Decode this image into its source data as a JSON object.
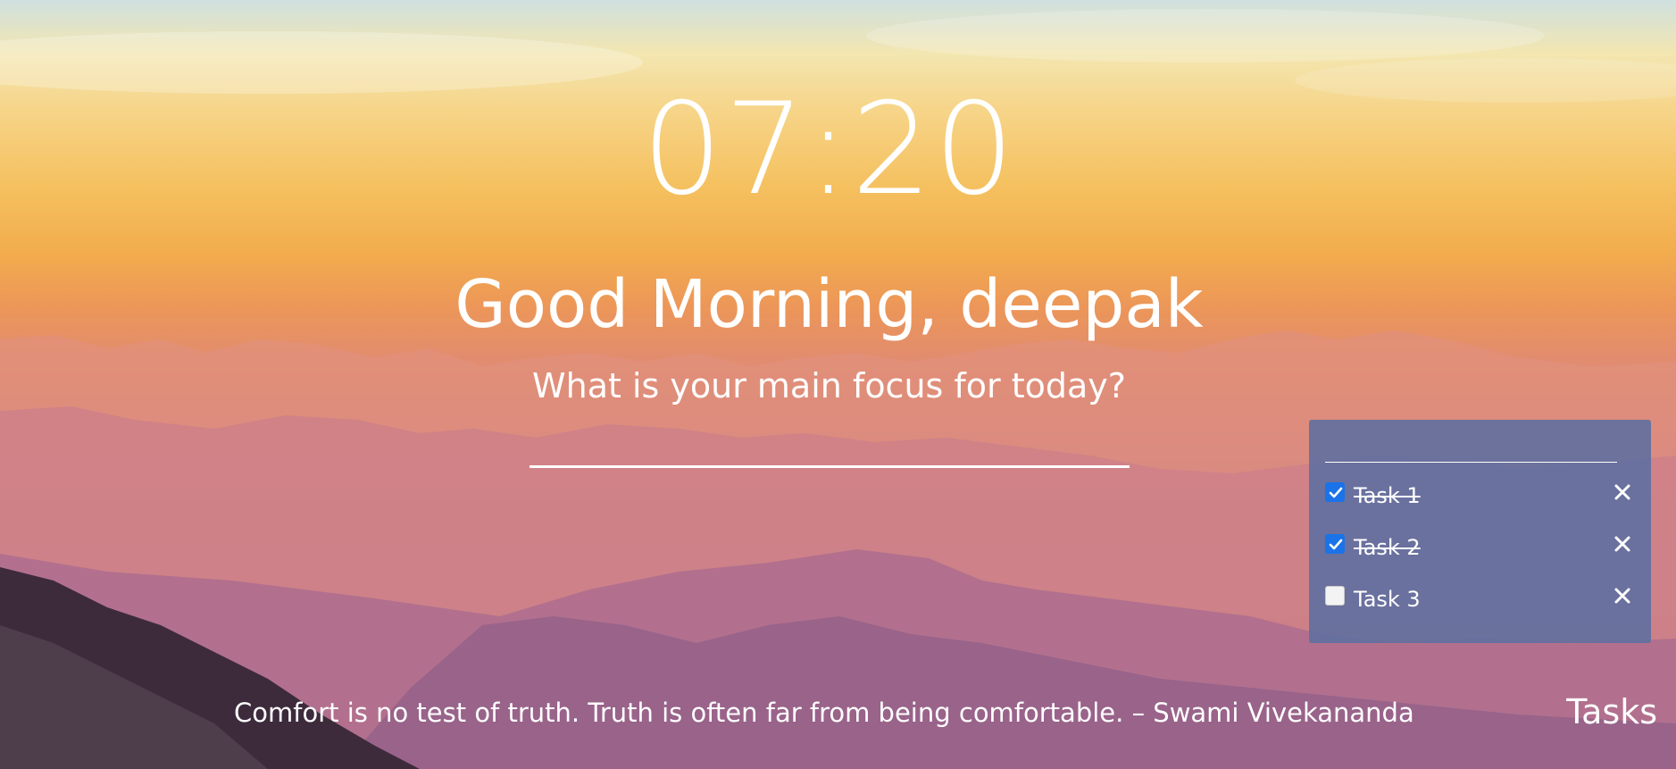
{
  "clock": {
    "time": "07:20"
  },
  "greeting": {
    "text": "Good Morning, deepak"
  },
  "focus": {
    "question": "What is your main focus for today?",
    "value": ""
  },
  "tasks": {
    "new_task_value": "",
    "items": [
      {
        "label": "Task 1",
        "done": true
      },
      {
        "label": "Task 2",
        "done": true
      },
      {
        "label": "Task 3",
        "done": false
      }
    ],
    "toggle_label": "Tasks"
  },
  "quote": {
    "text": "Comfort is no test of truth. Truth is often far from being comfortable. – Swami Vivekananda"
  },
  "colors": {
    "panel": "#5c6ea0",
    "checkbox_checked": "#1a73e8",
    "text": "#ffffff"
  }
}
